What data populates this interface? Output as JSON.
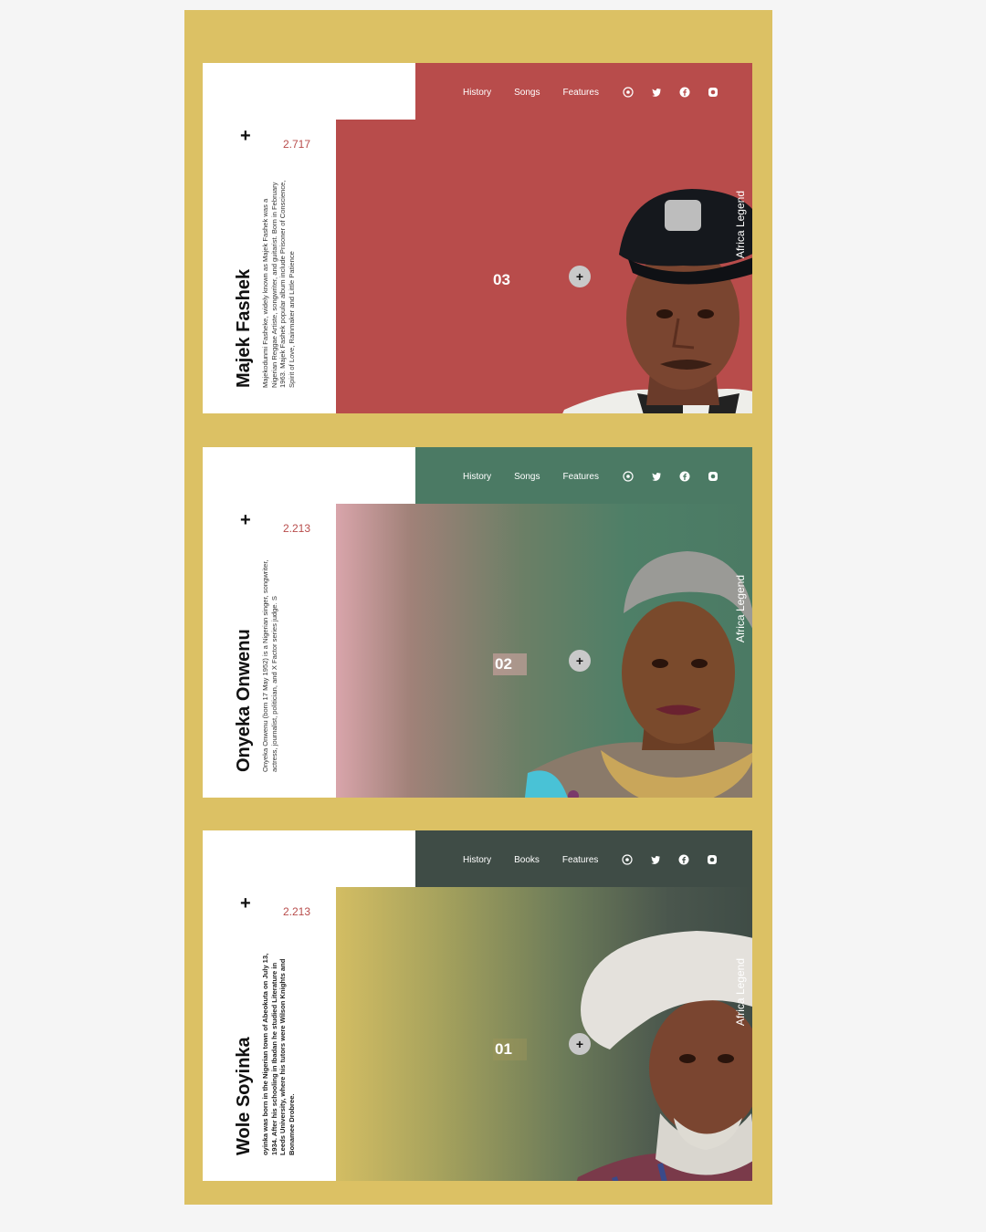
{
  "cards": [
    {
      "nav": [
        "History",
        "Songs",
        "Features"
      ],
      "count": "2.717",
      "name": "Majek Fashek",
      "description": "Majekodunmi Fasheke, widely known as Majek Fashek was a Nigerian Reggae Artiste, songwriter, and guitarist. Born in February 1963. Majek Fashek popular album include Prisoner of Conscience, Spirit of Love, Rainmaker and Little Patience",
      "index": "03",
      "legend": "Africa Legend"
    },
    {
      "nav": [
        "History",
        "Songs",
        "Features"
      ],
      "count": "2.213",
      "name": "Onyeka Onwenu",
      "description": "Onyeka Onwenu (born 17 May 1952) is a Nigerian singer, songwriter, actress, journalist, politician, and X Factor series judge. S",
      "index": "02",
      "legend": "Africa Legend"
    },
    {
      "nav": [
        "History",
        "Books",
        "Features"
      ],
      "count": "2.213",
      "name": "Wole Soyinka",
      "description": "oyinka was born in the Nigerian town of Abeokuta on July 13, 1934. After his schooling in Ibadan he studied Literature in Leeds University, where his tutors were Wilson Knights and Bonamee Drobree.",
      "index": "01",
      "legend": "Africa Legend"
    }
  ],
  "social_icons": [
    "whatsapp-icon",
    "twitter-icon",
    "facebook-icon",
    "instagram-icon"
  ],
  "colors": {
    "frame": "#dcc164",
    "card1": "#b84c4b",
    "card2": "#4b7a64",
    "card3": "#3f4c46",
    "accent_count": "#b84c4b"
  }
}
